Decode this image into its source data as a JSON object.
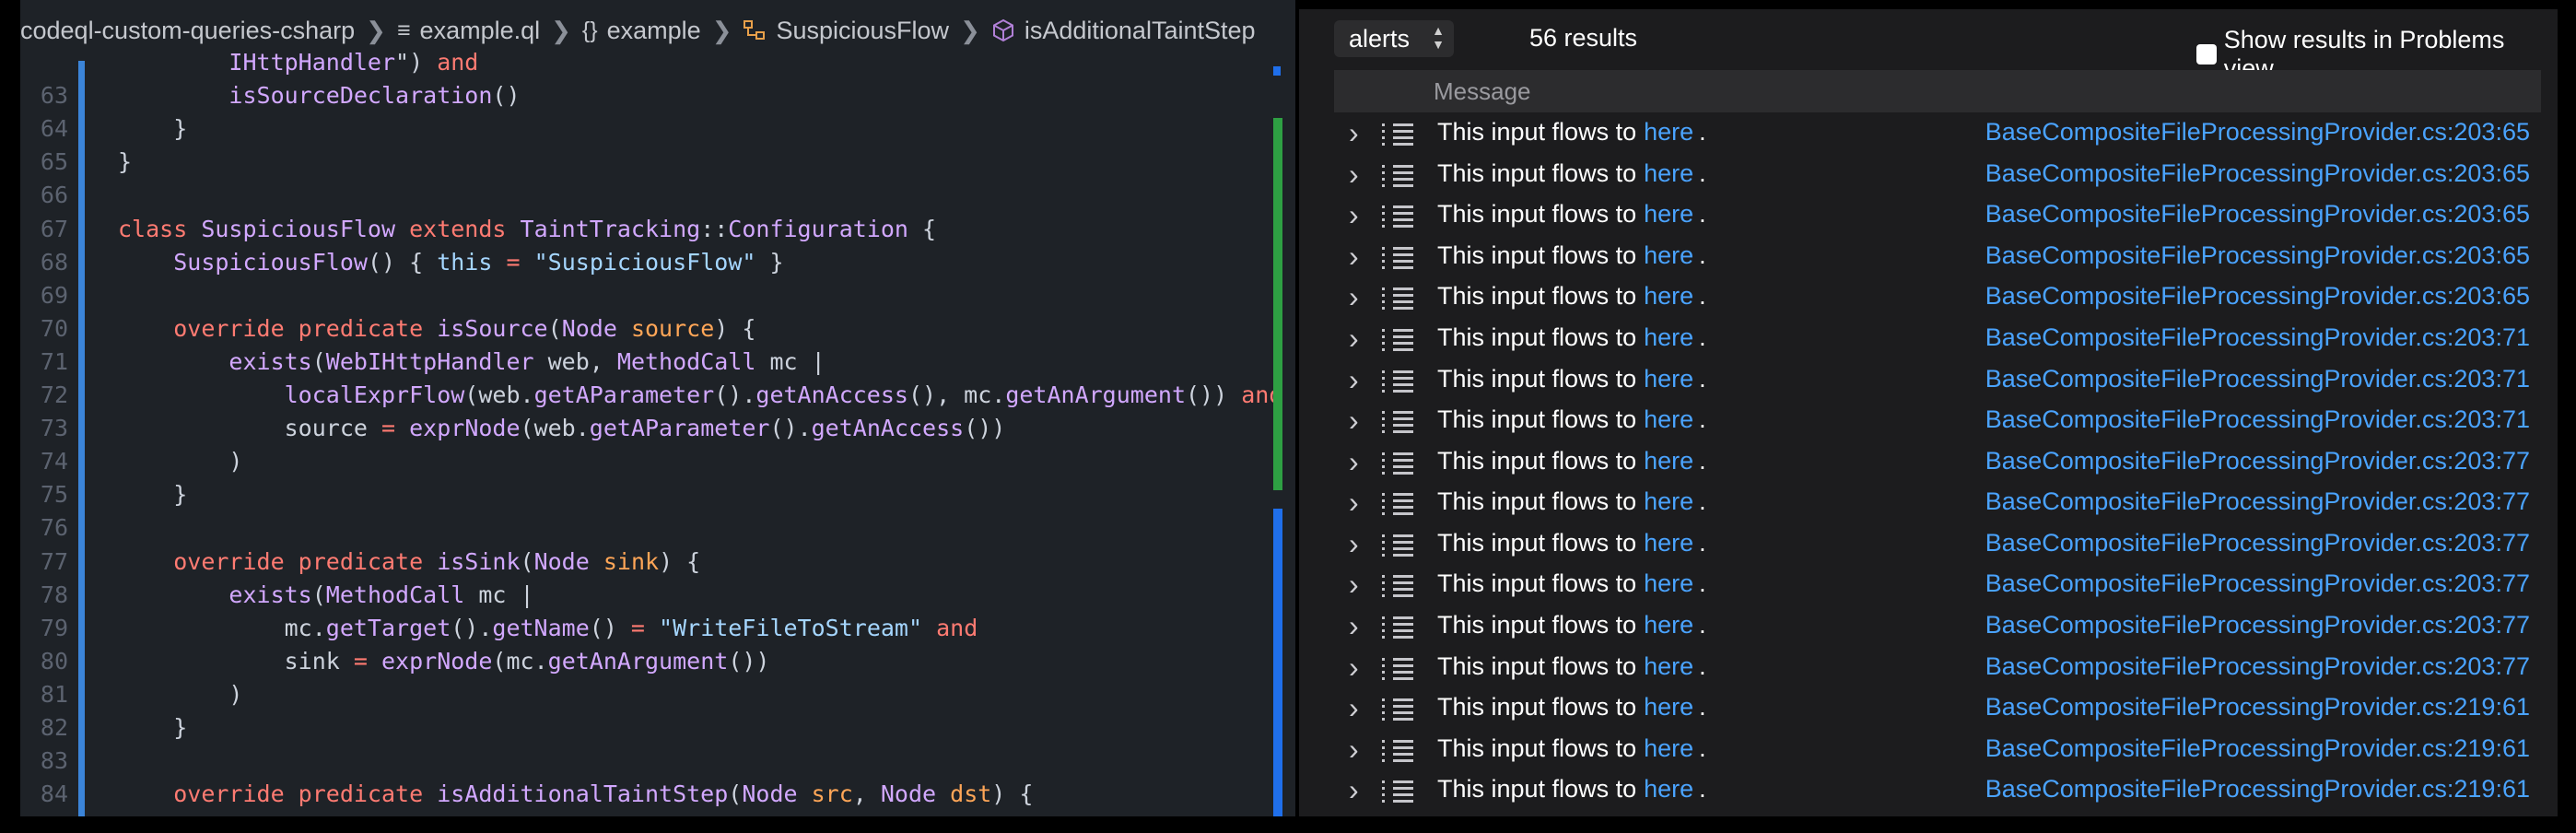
{
  "breadcrumb": {
    "items": [
      "codeql-custom-queries-csharp",
      "example.ql",
      "example",
      "SuspiciousFlow",
      "isAdditionalTaintStep"
    ]
  },
  "editor": {
    "lines": [
      {
        "n": "",
        "tokens": [
          [
            "sc",
            "        "
          ],
          [
            "ty",
            "IHttpHandler"
          ],
          [
            "sc",
            "\") "
          ],
          [
            "kw",
            "and"
          ]
        ]
      },
      {
        "n": "63",
        "tokens": [
          [
            "sc",
            "        "
          ],
          [
            "fn",
            "isSourceDeclaration"
          ],
          [
            "sc",
            "()"
          ]
        ]
      },
      {
        "n": "64",
        "tokens": [
          [
            "sc",
            "    }"
          ]
        ]
      },
      {
        "n": "65",
        "tokens": [
          [
            "sc",
            "}"
          ]
        ]
      },
      {
        "n": "66",
        "tokens": []
      },
      {
        "n": "67",
        "tokens": [
          [
            "kw",
            "class "
          ],
          [
            "ty",
            "SuspiciousFlow "
          ],
          [
            "kw",
            "extends "
          ],
          [
            "ty",
            "TaintTracking"
          ],
          [
            "sc",
            "::"
          ],
          [
            "ty",
            "Configuration"
          ],
          [
            "sc",
            " {"
          ]
        ]
      },
      {
        "n": "68",
        "tokens": [
          [
            "sc",
            "    "
          ],
          [
            "fn",
            "SuspiciousFlow"
          ],
          [
            "sc",
            "() { "
          ],
          [
            "str",
            "this"
          ],
          [
            "sc",
            " "
          ],
          [
            "kw",
            "="
          ],
          [
            "sc",
            " "
          ],
          [
            "str",
            "\"SuspiciousFlow\""
          ],
          [
            "sc",
            " }"
          ]
        ]
      },
      {
        "n": "69",
        "tokens": []
      },
      {
        "n": "70",
        "tokens": [
          [
            "sc",
            "    "
          ],
          [
            "kw",
            "override predicate "
          ],
          [
            "fn",
            "isSource"
          ],
          [
            "sc",
            "("
          ],
          [
            "ty",
            "Node "
          ],
          [
            "pa",
            "source"
          ],
          [
            "sc",
            ") {"
          ]
        ]
      },
      {
        "n": "71",
        "tokens": [
          [
            "sc",
            "        "
          ],
          [
            "fn",
            "exists"
          ],
          [
            "sc",
            "("
          ],
          [
            "ty",
            "WebIHttpHandler"
          ],
          [
            "sc",
            " web, "
          ],
          [
            "ty",
            "MethodCall"
          ],
          [
            "sc",
            " mc |"
          ]
        ]
      },
      {
        "n": "72",
        "tokens": [
          [
            "sc",
            "            "
          ],
          [
            "fn",
            "localExprFlow"
          ],
          [
            "sc",
            "(web."
          ],
          [
            "fn",
            "getAParameter"
          ],
          [
            "sc",
            "()."
          ],
          [
            "fn",
            "getAnAccess"
          ],
          [
            "sc",
            "(), mc."
          ],
          [
            "fn",
            "getAnArgument"
          ],
          [
            "sc",
            "()) "
          ],
          [
            "kw",
            "and"
          ]
        ]
      },
      {
        "n": "73",
        "tokens": [
          [
            "sc",
            "            source "
          ],
          [
            "kw",
            "="
          ],
          [
            "sc",
            " "
          ],
          [
            "fn",
            "exprNode"
          ],
          [
            "sc",
            "(web."
          ],
          [
            "fn",
            "getAParameter"
          ],
          [
            "sc",
            "()."
          ],
          [
            "fn",
            "getAnAccess"
          ],
          [
            "sc",
            "())"
          ]
        ]
      },
      {
        "n": "74",
        "tokens": [
          [
            "sc",
            "        )"
          ]
        ]
      },
      {
        "n": "75",
        "tokens": [
          [
            "sc",
            "    }"
          ]
        ]
      },
      {
        "n": "76",
        "tokens": []
      },
      {
        "n": "77",
        "tokens": [
          [
            "sc",
            "    "
          ],
          [
            "kw",
            "override predicate "
          ],
          [
            "fn",
            "isSink"
          ],
          [
            "sc",
            "("
          ],
          [
            "ty",
            "Node "
          ],
          [
            "pa",
            "sink"
          ],
          [
            "sc",
            ") {"
          ]
        ]
      },
      {
        "n": "78",
        "tokens": [
          [
            "sc",
            "        "
          ],
          [
            "fn",
            "exists"
          ],
          [
            "sc",
            "("
          ],
          [
            "ty",
            "MethodCall"
          ],
          [
            "sc",
            " mc |"
          ]
        ]
      },
      {
        "n": "79",
        "tokens": [
          [
            "sc",
            "            mc."
          ],
          [
            "fn",
            "getTarget"
          ],
          [
            "sc",
            "()."
          ],
          [
            "fn",
            "getName"
          ],
          [
            "sc",
            "() "
          ],
          [
            "kw",
            "="
          ],
          [
            "sc",
            " "
          ],
          [
            "str",
            "\"WriteFileToStream\""
          ],
          [
            "sc",
            " "
          ],
          [
            "kw",
            "and"
          ]
        ]
      },
      {
        "n": "80",
        "tokens": [
          [
            "sc",
            "            sink "
          ],
          [
            "kw",
            "="
          ],
          [
            "sc",
            " "
          ],
          [
            "fn",
            "exprNode"
          ],
          [
            "sc",
            "(mc."
          ],
          [
            "fn",
            "getAnArgument"
          ],
          [
            "sc",
            "())"
          ]
        ]
      },
      {
        "n": "81",
        "tokens": [
          [
            "sc",
            "        )"
          ]
        ]
      },
      {
        "n": "82",
        "tokens": [
          [
            "sc",
            "    }"
          ]
        ]
      },
      {
        "n": "83",
        "tokens": []
      },
      {
        "n": "84",
        "tokens": [
          [
            "sc",
            "    "
          ],
          [
            "kw",
            "override predicate "
          ],
          [
            "fn",
            "isAdditionalTaintStep"
          ],
          [
            "sc",
            "("
          ],
          [
            "ty",
            "Node "
          ],
          [
            "pa",
            "src"
          ],
          [
            "sc",
            ", "
          ],
          [
            "ty",
            "Node "
          ],
          [
            "pa",
            "dst"
          ],
          [
            "sc",
            ") {"
          ]
        ]
      }
    ]
  },
  "results": {
    "select_value": "alerts",
    "count_text": "56 results",
    "problems_label": "Show results in Problems view",
    "column_header": "Message",
    "message_prefix": "This input flows to",
    "link_text": "here",
    "rows": [
      "BaseCompositeFileProcessingProvider.cs:203:65",
      "BaseCompositeFileProcessingProvider.cs:203:65",
      "BaseCompositeFileProcessingProvider.cs:203:65",
      "BaseCompositeFileProcessingProvider.cs:203:65",
      "BaseCompositeFileProcessingProvider.cs:203:65",
      "BaseCompositeFileProcessingProvider.cs:203:71",
      "BaseCompositeFileProcessingProvider.cs:203:71",
      "BaseCompositeFileProcessingProvider.cs:203:71",
      "BaseCompositeFileProcessingProvider.cs:203:77",
      "BaseCompositeFileProcessingProvider.cs:203:77",
      "BaseCompositeFileProcessingProvider.cs:203:77",
      "BaseCompositeFileProcessingProvider.cs:203:77",
      "BaseCompositeFileProcessingProvider.cs:203:77",
      "BaseCompositeFileProcessingProvider.cs:203:77",
      "BaseCompositeFileProcessingProvider.cs:219:61",
      "BaseCompositeFileProcessingProvider.cs:219:61",
      "BaseCompositeFileProcessingProvider.cs:219:61"
    ]
  },
  "colors": {
    "keyword": "#ff7b72",
    "type": "#d2a8ff",
    "string": "#a5d6ff",
    "param": "#ffa657",
    "link": "#4aa3ff"
  },
  "icons": [
    "chevron-right-icon",
    "file-lines-icon",
    "braces-icon",
    "class-icon",
    "cube-icon",
    "list-icon",
    "up-down-arrows-icon"
  ]
}
